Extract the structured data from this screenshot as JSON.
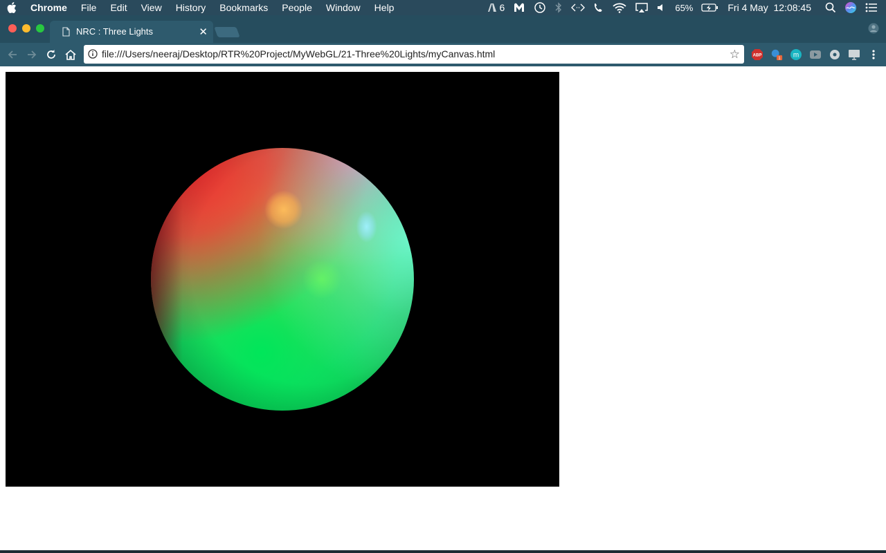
{
  "menubar": {
    "app_name": "Chrome",
    "menus": [
      "File",
      "Edit",
      "View",
      "History",
      "Bookmarks",
      "People",
      "Window",
      "Help"
    ],
    "status": {
      "adobe_count": "6",
      "battery_percent": "65%",
      "datetime": "Fri 4 May  12:08:45"
    },
    "icons": [
      "apple-icon",
      "adobe-icon",
      "malwarebytes-icon",
      "time-machine-icon",
      "bluetooth-icon",
      "script-icon",
      "phone-icon",
      "wifi-icon",
      "airplay-icon",
      "volume-icon",
      "battery-icon",
      "spotlight-icon",
      "siri-icon",
      "notification-center-icon"
    ]
  },
  "tab": {
    "title": "NRC : Three Lights",
    "icon": "page-icon"
  },
  "toolbar": {
    "url": "file:///Users/neeraj/Desktop/RTR%20Project/MyWebGL/21-Three%20Lights/myCanvas.html",
    "extensions": [
      {
        "name": "adblock-icon",
        "label": "ABP",
        "color": "#d0312d"
      },
      {
        "name": "extension-badge-icon",
        "badge": "1",
        "color": "#3a8fd6"
      },
      {
        "name": "m-extension-icon",
        "label": "m",
        "color": "#19b5c2"
      },
      {
        "name": "video-extension-icon",
        "color": "#9aa7ad"
      },
      {
        "name": "settings-extension-icon",
        "color": "#cfd6d9"
      },
      {
        "name": "screen-extension-icon",
        "color": "#cfd6d9"
      }
    ]
  },
  "canvas": {
    "background": "#000000",
    "scene": "sphere lit by three lights (red, green, blue)"
  },
  "colors": {
    "menubar": "#2a4a5c",
    "tabstrip": "#264d5e",
    "toolbar": "#2e5a6d"
  }
}
